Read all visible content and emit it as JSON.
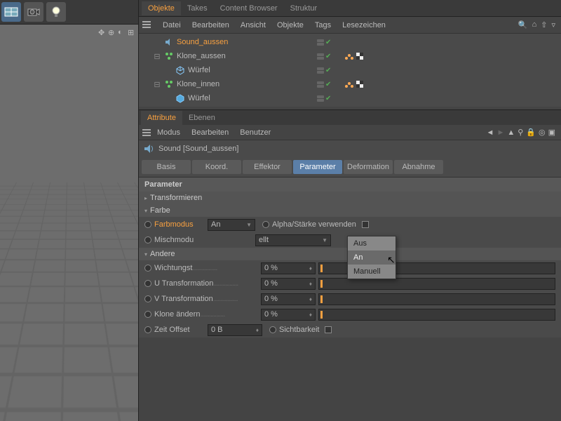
{
  "top_tabs": {
    "objects": "Objekte",
    "takes": "Takes",
    "content": "Content Browser",
    "structure": "Struktur"
  },
  "menubar": [
    "Datei",
    "Bearbeiten",
    "Ansicht",
    "Objekte",
    "Tags",
    "Lesezeichen"
  ],
  "tree": [
    {
      "label": "Sound_aussen",
      "selected": true,
      "indent": 1,
      "icon": "sound",
      "exp": ""
    },
    {
      "label": "Klone_aussen",
      "selected": false,
      "indent": 1,
      "icon": "cloner",
      "exp": "⊟",
      "tags": true
    },
    {
      "label": "Würfel",
      "selected": false,
      "indent": 2,
      "icon": "cube",
      "exp": ""
    },
    {
      "label": "Klone_innen",
      "selected": false,
      "indent": 1,
      "icon": "cloner",
      "exp": "⊟",
      "tags": true
    },
    {
      "label": "Würfel",
      "selected": false,
      "indent": 2,
      "icon": "cube2",
      "exp": ""
    }
  ],
  "attr_tabs": {
    "attribute": "Attribute",
    "ebenen": "Ebenen"
  },
  "attr_menu": [
    "Modus",
    "Bearbeiten",
    "Benutzer"
  ],
  "obj_title": "Sound [Sound_aussen]",
  "ptabs": [
    "Basis",
    "Koord.",
    "Effektor",
    "Parameter",
    "Deformation",
    "Abnahme"
  ],
  "section": "Parameter",
  "sub": {
    "transformieren": "Transformieren",
    "farbe": "Farbe",
    "andere": "Andere"
  },
  "params": {
    "farbmodus": {
      "label": "Farbmodus",
      "value": "An"
    },
    "alpha": {
      "label": "Alpha/Stärke verwenden"
    },
    "mischmodus": {
      "label": "Mischmodu"
    },
    "mischmodus_value": "ellt",
    "wichtung": {
      "label": "Wichtungst",
      "value": "0 %"
    },
    "utrans": {
      "label": "U Transformation",
      "value": "0 %"
    },
    "vtrans": {
      "label": "V Transformation",
      "value": "0 %"
    },
    "klone": {
      "label": "Klone ändern",
      "value": "0 %"
    },
    "zeit": {
      "label": "Zeit Offset",
      "value": "0 B"
    },
    "sichtbarkeit": {
      "label": "Sichtbarkeit"
    }
  },
  "popup": [
    "Aus",
    "An",
    "Manuell"
  ]
}
